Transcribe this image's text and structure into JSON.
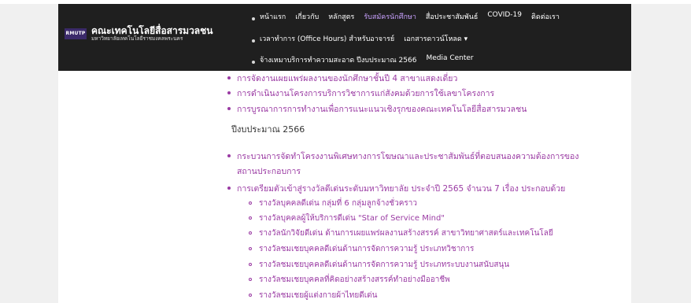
{
  "site": {
    "logo_badge": "RMUTP",
    "logo_title": "คณะเทคโนโลยีสื่อสารมวลชน",
    "logo_subtitle": "มหาวิทยาลัยเทคโนโลยีราชมงคลพระนคร"
  },
  "nav": {
    "row1": [
      "หน้าแรก",
      "เกี่ยวกับ",
      "หลักสูตร",
      "รับสมัครนักศึกษา",
      "สื่อประชาสัมพันธ์",
      "COVID-19",
      "ติดต่อเรา"
    ],
    "row2": [
      "เวลาทำการ (Office Hours) สำหรับอาจารย์",
      "เอกสารดาวน์โหลด ▾"
    ],
    "row3": [
      "จ้างเหมาบริการทำความสะอาด ปีงบประมาณ 2566",
      "Media Center"
    ],
    "active_index": 3
  },
  "content": {
    "items_top": [
      "การจัดงานเผยแพร่ผลงานของนักศึกษาชั้นปี 4 สาขาแสดงเดี่ยว",
      "การดำเนินงานโครงการบริการวิชาการแก่สังคมด้วยการใช้เลขาโครงการ",
      "การบูรณาการการทำงานเพื่อการแนะแนวเชิงรุกของคณะเทคโนโลยีสื่อสารมวลชน"
    ],
    "year_heading": "ปีงบประมาณ 2566",
    "item_process_line1": "กระบวนการจัดทำโครงงานพิเศษทางการโฆษณาและประชาสัมพันธ์ที่ตอบสนองความต้องการของ",
    "item_process_line2": "สถานประกอบการ",
    "item_awards": "การเตรียมตัวเข้าสู่รางวัลดีเด่นระดับมหาวิทยาลัย ประจำปี 2565 จำนวน 7 เรื่อง ประกอบด้วย",
    "sub_items": [
      "รางวัลบุคคลดีเด่น กลุ่มที่ 6 กลุ่มลูกจ้างชั่วคราว",
      "รางวัลบุคคลผู้ให้บริการดีเด่น \"Star of Service Mind\"",
      "รางวัลนักวิจัยดีเด่น ด้านการเผยแพร่ผลงานสร้างสรรค์ สาขาวิทยาศาสตร์และเทคโนโลยี",
      "รางวัลชมเชยบุคคลดีเด่นด้านการจัดการความรู้ ประเภทวิชาการ",
      "รางวัลชมเชยบุคคลดีเด่นด้านการจัดการความรู้ ประเภทระบบงานสนับสนุน",
      "รางวัลชมเชยบุคคลที่คิดอย่างสร้างสรรค์ทำอย่างมืออาชีพ",
      "รางวัลชมเชยผู้แต่งกายผ้าไทยดีเด่น"
    ]
  }
}
